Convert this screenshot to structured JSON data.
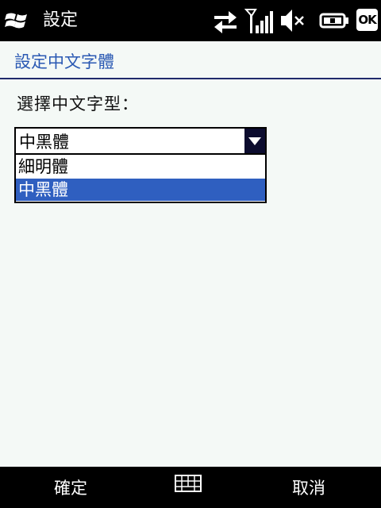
{
  "titlebar": {
    "app_title": "設定",
    "ok_label": "OK",
    "icons": [
      "windows-start-icon",
      "connectivity-icon",
      "signal-icon",
      "volume-muted-icon",
      "battery-charging-icon"
    ]
  },
  "page": {
    "header": "設定中文字體",
    "field_label": "選擇中文字型："
  },
  "font_select": {
    "selected": "中黑體",
    "options": [
      "細明體",
      "中黑體"
    ],
    "highlighted_index": 1
  },
  "softkeys": {
    "left": "確定",
    "right": "取消",
    "center_icon": "keyboard-icon"
  },
  "colors": {
    "bar_background": "#000000",
    "header_text": "#2a59b3",
    "selection": "#2f5fc0",
    "page_background": "#f4f9f6"
  }
}
